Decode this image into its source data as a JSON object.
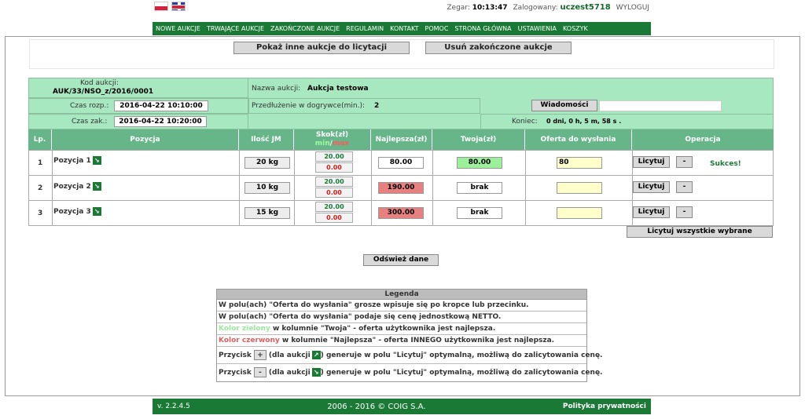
{
  "header": {
    "clock_label": "Zegar:",
    "clock_value": "10:13:47",
    "logged_label": "Zalogowany:",
    "username": "uczest5718",
    "logout": "WYLOGUJ"
  },
  "menu": [
    "NOWE AUKCJE",
    "TRWAJĄCE AUKCJE",
    "ZAKOŃCZONE AUKCJE",
    "REGULAMIN",
    "KONTAKT",
    "POMOC",
    "STRONA GŁÓWNA",
    "USTAWIENIA",
    "KOSZYK"
  ],
  "top_buttons": {
    "show_other": "Pokaż inne aukcje do licytacji",
    "remove_finished": "Usuń zakończone aukcje"
  },
  "auction": {
    "code_label": "Kod aukcji:",
    "code_value": "AUK/33/NSO_z/2016/0001",
    "name_label": "Nazwa aukcji:",
    "name_value": "Aukcja testowa",
    "start_label": "Czas rozp.:",
    "start_value": "2016-04-22 10:10:00",
    "extension_label": "Przedłużenie w dogrywce(min.):",
    "extension_value": "2",
    "messages_button": "Wiadomości",
    "end_label": "Czas zak.:",
    "end_value": "2016-04-22 10:20:00",
    "ending_label": "Koniec:",
    "ending_value": "0 dni, 0 h, 5 m, 58 s ."
  },
  "columns": {
    "lp": "Lp.",
    "position": "Pozycja",
    "qty": "Ilość JM",
    "skok": "Skok(zł)",
    "skok_min": "min",
    "skok_sep": "/",
    "skok_max": "max",
    "best": "Najlepsza(zł)",
    "yours": "Twoja(zł)",
    "offer": "Oferta do wysłania",
    "ops": "Operacja"
  },
  "rows": [
    {
      "lp": "1",
      "name": "Pozycja 1",
      "qty": "20 kg",
      "skok_min": "20.00",
      "skok_max": "0.00",
      "best": "80.00",
      "yours": "80.00",
      "offer": "80",
      "bid": "Licytuj",
      "minus": "-",
      "status": "Sukces!"
    },
    {
      "lp": "2",
      "name": "Pozycja 2",
      "qty": "10 kg",
      "skok_min": "20.00",
      "skok_max": "0.00",
      "best": "190.00",
      "yours": "brak",
      "offer": "",
      "bid": "Licytuj",
      "minus": "-",
      "status": ""
    },
    {
      "lp": "3",
      "name": "Pozycja 3",
      "qty": "15 kg",
      "skok_min": "20.00",
      "skok_max": "0.00",
      "best": "300.00",
      "yours": "brak",
      "offer": "",
      "bid": "Licytuj",
      "minus": "-",
      "status": ""
    }
  ],
  "bid_all": "Licytuj wszystkie wybrane",
  "refresh": "Odśwież dane",
  "legend": {
    "title": "Legenda",
    "line1": "W polu(ach) \"Oferta do wysłania\" grosze wpisuje się po kropce lub przecinku.",
    "line2": "W polu(ach) \"Oferta do wysłania\" podaje się cenę jednostkową NETTO.",
    "line3_color": "Kolor zielony",
    "line3_rest": " w kolumnie \"Twoja\" - oferta użytkownika jest najlepsza.",
    "line4_color": "Kolor czerwony",
    "line4_rest": " w kolumnie \"Najlepsza\" - oferta INNEGO użytkownika jest najlepsza.",
    "line5_pre": "Przycisk",
    "line5_btn": "+",
    "line5_mid": "(dla aukcji",
    "line5_rest": ") generuje w polu \"Licytuj\" optymalną, możliwą do zalicytowania cenę.",
    "line6_pre": "Przycisk",
    "line6_btn": "-",
    "line6_mid": "(dla aukcji",
    "line6_rest": ") generuje w polu \"Licytuj\" optymalną, możliwą do zalicytowania cenę."
  },
  "footer": {
    "version": "v. 2.2.4.5",
    "copyright": "2006 - 2016 © COIG S.A.",
    "privacy": "Polityka prywatności"
  },
  "colors": {
    "green_dark": "#1a7a35",
    "header_light": "#a8e8c0",
    "column_header": "#66b68a",
    "best_red": "#e98080",
    "yours_green": "#9cf09c",
    "offer_yellow": "#ffffcc"
  }
}
